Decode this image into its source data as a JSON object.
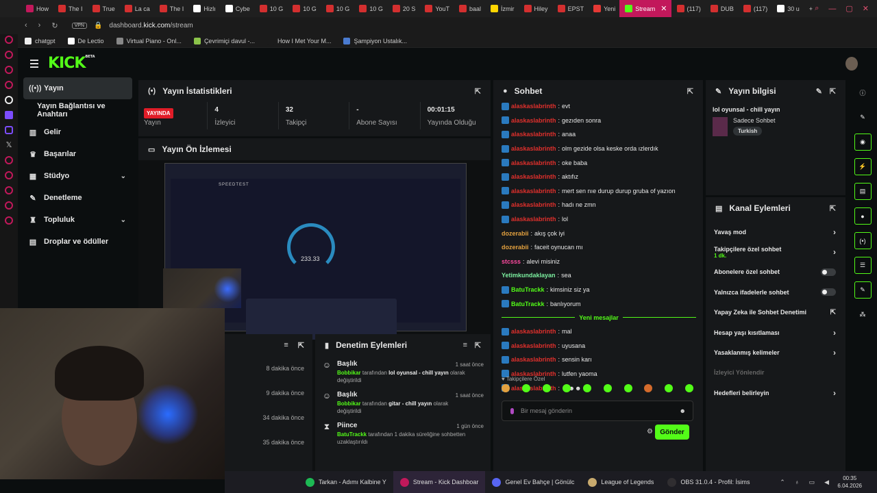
{
  "browser": {
    "tabs": [
      {
        "label": "How",
        "color": "#c2185b"
      },
      {
        "label": "The I",
        "color": "#d32f2f"
      },
      {
        "label": "True",
        "color": "#d32f2f"
      },
      {
        "label": "La ca",
        "color": "#d32f2f"
      },
      {
        "label": "The I",
        "color": "#d32f2f"
      },
      {
        "label": "Hizlı",
        "color": "#ffffff"
      },
      {
        "label": "Cybe",
        "color": "#ffffff"
      },
      {
        "label": "10 G",
        "color": "#d32f2f"
      },
      {
        "label": "10 G",
        "color": "#d32f2f"
      },
      {
        "label": "10 G",
        "color": "#d32f2f"
      },
      {
        "label": "10 G",
        "color": "#d32f2f"
      },
      {
        "label": "20 S",
        "color": "#d32f2f"
      },
      {
        "label": "YouT",
        "color": "#d32f2f"
      },
      {
        "label": "baal",
        "color": "#d32f2f"
      },
      {
        "label": "İzmir",
        "color": "#ffd600"
      },
      {
        "label": "Hiley",
        "color": "#d32f2f"
      },
      {
        "label": "EPST",
        "color": "#d32f2f"
      },
      {
        "label": "Yeni",
        "color": "#e53935"
      },
      {
        "label": "Stream",
        "color": "#53fc18",
        "active": true
      },
      {
        "label": "(117)",
        "color": "#d32f2f"
      },
      {
        "label": "DUB",
        "color": "#d32f2f"
      },
      {
        "label": "(117)",
        "color": "#d32f2f"
      },
      {
        "label": "30 u",
        "color": "#ffffff"
      }
    ],
    "new_tab": "+",
    "vpn": "VPN",
    "url_host": "dashboard.",
    "url_bold": "kick.com",
    "url_path": "/stream",
    "bookmarks": [
      {
        "label": "chatgpt",
        "color": "#eeeeee"
      },
      {
        "label": "De Lectio",
        "color": "#ffffff"
      },
      {
        "label": "Virtual Piano - Onl...",
        "color": "#888888"
      },
      {
        "label": "Çevrimiçi davul -...",
        "color": "#8bc34a"
      },
      {
        "label": "How I Met Your M...",
        "color": "#1b1b1b"
      },
      {
        "label": "Şampiyon Ustalık...",
        "color": "#4a7bd0"
      }
    ]
  },
  "kick": {
    "logo": "KICK",
    "beta": "BETA",
    "sidebar": {
      "items": [
        {
          "label": "Yayın",
          "icon": "broadcast-icon",
          "glyph": "((•))",
          "active": true
        },
        {
          "label": "Yayın Bağlantısı ve Anahtarı",
          "sub": true
        },
        {
          "label": "Gelir",
          "icon": "chart-icon",
          "glyph": "▥"
        },
        {
          "label": "Başarılar",
          "icon": "trophy-icon",
          "glyph": "♛"
        },
        {
          "label": "Stüdyo",
          "icon": "studio-icon",
          "glyph": "▦",
          "chevron": true
        },
        {
          "label": "Denetleme",
          "icon": "wrench-icon",
          "glyph": "✎"
        },
        {
          "label": "Topluluk",
          "icon": "community-icon",
          "glyph": "♜",
          "chevron": true
        },
        {
          "label": "Droplar ve ödüller",
          "icon": "gift-icon",
          "glyph": "▤"
        }
      ]
    },
    "stats_panel": {
      "title": "Yayın İstatistikleri",
      "live_badge": "YAYINDA",
      "stats": [
        {
          "value": "",
          "label": "Yayın"
        },
        {
          "value": "4",
          "label": "İzleyici"
        },
        {
          "value": "32",
          "label": "Takipçi"
        },
        {
          "value": "-",
          "label": "Abone Sayısı"
        },
        {
          "value": "00:01:15",
          "label": "Yayında Olduğu"
        }
      ]
    },
    "preview_panel": {
      "title": "Yayın Ön İzlemesi",
      "speedtest_label": "SPEEDTEST",
      "speed_value": "233.33"
    },
    "events_panel": {
      "times": [
        "8 dakika önce",
        "9 dakika önce",
        "34 dakika önce",
        "35 dakika önce"
      ]
    },
    "mod_panel": {
      "title": "Denetim Eylemleri",
      "items": [
        {
          "title": "Başlık",
          "time": "1 saat önce",
          "user": "Bobbikar",
          "mid": " tarafından ",
          "target": "lol oyunsal - chill yayın",
          "tail": " olarak değiştirildi",
          "icon": "user-icon",
          "glyph": "☺"
        },
        {
          "title": "Başlık",
          "time": "1 saat önce",
          "user": "Bobbikar",
          "mid": " tarafından ",
          "target": "gitar - chill yayın",
          "tail": " olarak değiştirildi",
          "icon": "user-icon",
          "glyph": "☺"
        },
        {
          "title": "Piince",
          "time": "1 gün önce",
          "user": "BatuTrackk",
          "mid": " tarafından 1 dakika süreliğine sohbetten uzaklaştırıldı",
          "target": "",
          "tail": "",
          "icon": "hourglass-icon",
          "glyph": "⧗"
        }
      ]
    },
    "chat_panel": {
      "title": "Sohbet",
      "messages": [
        {
          "user": "alaskaslabrinth",
          "cls": "red",
          "badge": true,
          "text": "evt"
        },
        {
          "user": "alaskaslabrinth",
          "cls": "red",
          "badge": true,
          "text": "gezıden sonra"
        },
        {
          "user": "alaskaslabrinth",
          "cls": "red",
          "badge": true,
          "text": "anaa"
        },
        {
          "user": "alaskaslabrinth",
          "cls": "red",
          "badge": true,
          "text": "olm gezide olsa keske orda ızlerdık"
        },
        {
          "user": "alaskaslabrinth",
          "cls": "red",
          "badge": true,
          "text": "oke baba"
        },
        {
          "user": "alaskaslabrinth",
          "cls": "red",
          "badge": true,
          "text": "aktıfız"
        },
        {
          "user": "alaskaslabrinth",
          "cls": "red",
          "badge": true,
          "text": "mert sen nıe durup durup gruba of yazıon"
        },
        {
          "user": "alaskaslabrinth",
          "cls": "red",
          "badge": true,
          "text": "hadı ne zmn"
        },
        {
          "user": "alaskaslabrinth",
          "cls": "red",
          "badge": true,
          "text": "lol"
        },
        {
          "user": "dozerabii",
          "cls": "gold",
          "badge": false,
          "text": "akış çok iyi"
        },
        {
          "user": "dozerabii",
          "cls": "gold",
          "badge": false,
          "text": "faceit oynucan mı"
        },
        {
          "user": "stcsss",
          "cls": "pink",
          "badge": false,
          "text": "alevi misiniz"
        },
        {
          "user": "Yetimkundaklayan",
          "cls": "mint",
          "badge": false,
          "text": "sea"
        },
        {
          "user": "BatuTrackk",
          "cls": "green",
          "badge": true,
          "text": "kimsiniz siz ya"
        },
        {
          "user": "BatuTrackk",
          "cls": "green",
          "badge": true,
          "text": "banlıyorum"
        }
      ],
      "new_label": "Yeni mesajlar",
      "new_messages": [
        {
          "user": "alaskaslabrinth",
          "cls": "red",
          "badge": true,
          "text": "mal"
        },
        {
          "user": "alaskaslabrinth",
          "cls": "red",
          "badge": true,
          "text": "uyusana"
        },
        {
          "user": "alaskaslabrinth",
          "cls": "red",
          "badge": true,
          "text": "sensin karı"
        },
        {
          "user": "alaskaslabrinth",
          "cls": "red",
          "badge": true,
          "text": "lutfen yaoma"
        },
        {
          "user": "alaskaslabrinth",
          "cls": "red",
          "badge": true,
          "text": "☻☻☻"
        }
      ],
      "emoji_header": "♥ Takipçilere Özel",
      "input_placeholder": "Bir mesaj gönderin",
      "send_label": "Gönder"
    },
    "info_panel": {
      "title": "Yayın bilgisi",
      "stream_title": "lol oyunsal - chill yayın",
      "category": "Sadece Sohbet",
      "tag": "Turkish"
    },
    "channel_actions": {
      "title": "Kanal Eylemleri",
      "items": [
        {
          "label": "Yavaş mod",
          "control": "chevron"
        },
        {
          "label": "Takipçilere özel sohbet",
          "sub": "1 dk.",
          "control": "chevron"
        },
        {
          "label": "Abonelere özel sohbet",
          "control": "toggle"
        },
        {
          "label": "Yalnızca ifadelerle sohbet",
          "control": "toggle"
        },
        {
          "label": "Yapay Zeka ile Sohbet Denetimi",
          "control": "external"
        },
        {
          "label": "Hesap yaşı kısıtlaması",
          "control": "chevron"
        },
        {
          "label": "Yasaklanmış kelimeler",
          "control": "chevron"
        },
        {
          "label": "İzleyici Yönlendir",
          "control": "none",
          "dim": true
        },
        {
          "label": "Hedefleri belirleyin",
          "control": "chevron"
        }
      ]
    }
  },
  "taskbar": {
    "items": [
      {
        "label": "Tarkan - Adımı Kalbine Y",
        "color": "#1db954"
      },
      {
        "label": "Stream - Kick Dashboar",
        "color": "#c2185b",
        "active": true
      },
      {
        "label": "Genel Ev Bahçe | Gönülc",
        "color": "#5865f2"
      },
      {
        "label": "League of Legends",
        "color": "#c8aa6e"
      },
      {
        "label": "OBS 31.0.4 - Profil: İsims",
        "color": "#302e31"
      }
    ],
    "time": "00:35",
    "date": "6.04.2026"
  }
}
